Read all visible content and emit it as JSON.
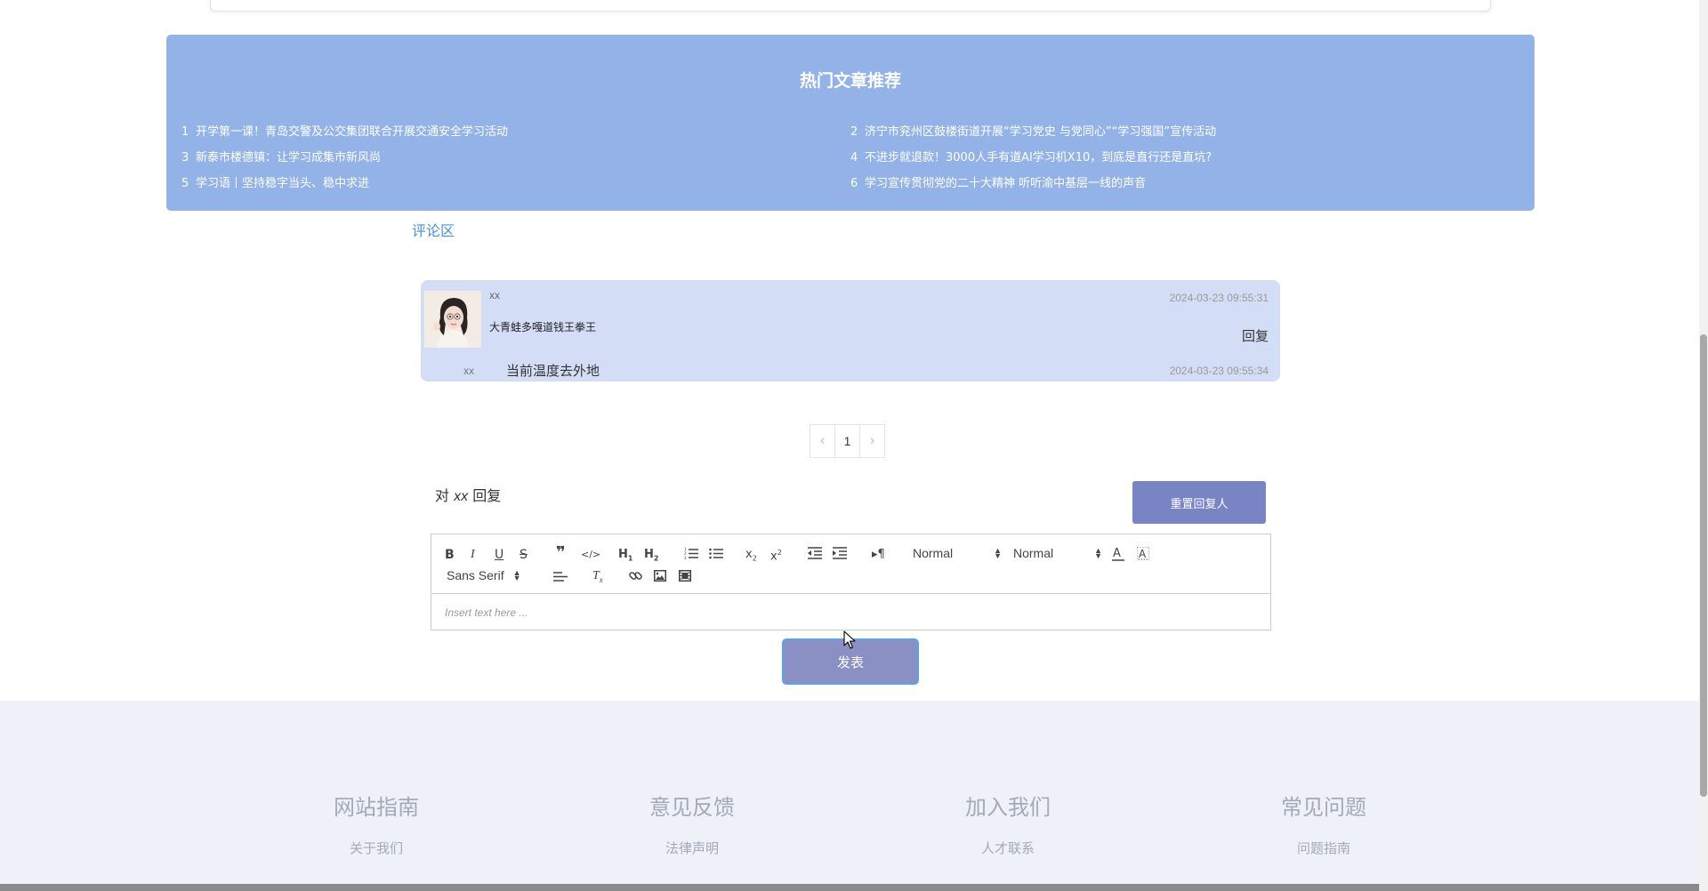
{
  "hot_articles": {
    "title": "热门文章推荐",
    "items": [
      {
        "num": "1",
        "text": "开学第一课！青岛交警及公交集团联合开展交通安全学习活动"
      },
      {
        "num": "2",
        "text": "济宁市兖州区鼓楼街道开展“学习党史 与党同心”“学习强国”宣传活动"
      },
      {
        "num": "3",
        "text": "新泰市楼德镇：让学习成集市新风尚"
      },
      {
        "num": "4",
        "text": "不进步就退款！3000人手有道AI学习机X10，到底是直行还是直坑?"
      },
      {
        "num": "5",
        "text": "学习语丨坚持稳字当头、稳中求进"
      },
      {
        "num": "6",
        "text": "学习宣传贯彻党的二十大精神 听听渝中基层一线的声音"
      }
    ]
  },
  "comments": {
    "section_label": "评论区",
    "items": [
      {
        "user": "xx",
        "text": "大青蛙多嘎道钱王拳王",
        "time": "2024-03-23 09:55:31",
        "reply_label": "回复",
        "replies": [
          {
            "user": "xx",
            "text": "当前温度去外地",
            "time": "2024-03-23 09:55:34"
          }
        ]
      }
    ]
  },
  "pagination": {
    "prev": "‹",
    "current": "1",
    "next": "›"
  },
  "reply_form": {
    "prefix": "对",
    "target": "xx",
    "suffix": "回复",
    "reset_label": "重置回复人",
    "submit_label": "发表"
  },
  "editor": {
    "header_select": "Normal",
    "size_select": "Normal",
    "font_select": "Sans Serif",
    "placeholder": "Insert text here ..."
  },
  "footer": {
    "columns": [
      {
        "title": "网站指南",
        "link": "关于我们"
      },
      {
        "title": "意见反馈",
        "link": "法律声明"
      },
      {
        "title": "加入我们",
        "link": "人才联系"
      },
      {
        "title": "常见问题",
        "link": "问题指南"
      }
    ]
  }
}
